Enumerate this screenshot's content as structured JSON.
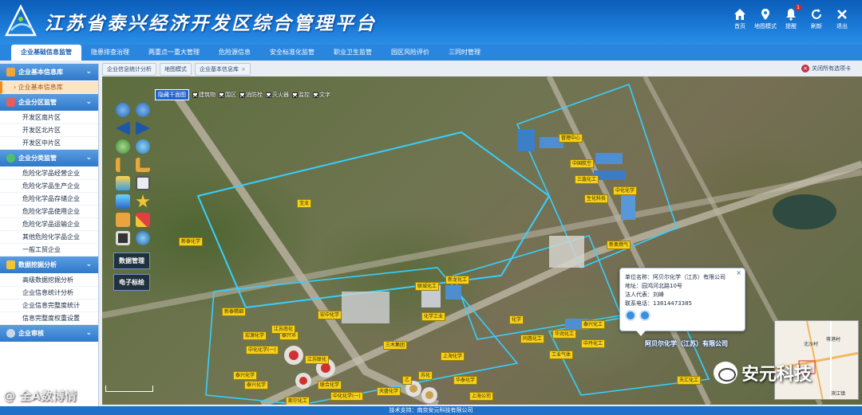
{
  "app": {
    "title": "江苏省泰兴经济开发区综合管理平台",
    "footer": "技术支持：南京安元科技有限公司"
  },
  "top_actions": [
    {
      "label": "首页",
      "icon": "home-icon"
    },
    {
      "label": "地图模式",
      "icon": "map-pin-icon"
    },
    {
      "label": "提醒",
      "icon": "bell-icon",
      "badge": "1"
    },
    {
      "label": "刷新",
      "icon": "refresh-icon"
    },
    {
      "label": "退出",
      "icon": "close-icon"
    }
  ],
  "main_nav": [
    "企业基础信息监管",
    "隐患排查治理",
    "两重点一重大管理",
    "危险源信息",
    "安全标准化监管",
    "职业卫生监管",
    "园区风险评价",
    "三同时管理"
  ],
  "sidebar": {
    "sections": [
      {
        "title": "企业基本信息库",
        "items": [
          "企业基本信息库"
        ]
      },
      {
        "title": "企业分区监管",
        "items": [
          "开发区南片区",
          "开发区北片区",
          "开发区中片区"
        ]
      },
      {
        "title": "企业分类监管",
        "items": [
          "危险化学品经营企业",
          "危险化学品生产企业",
          "危险化学品存储企业",
          "危险化学品使用企业",
          "危险化学品运输企业",
          "其他危险化学品企业",
          "一般工贸企业"
        ]
      },
      {
        "title": "数据挖掘分析",
        "items": [
          "高级数据挖掘分析",
          "企业信息统计分析",
          "企业信息完整度统计",
          "信息完整度权重设置"
        ]
      },
      {
        "title": "企业审核",
        "items": []
      }
    ],
    "active_item": "企业基本信息库"
  },
  "sub_tabs": [
    "企业信息统计分析",
    "地图模式",
    "企业基本信息库"
  ],
  "close_all_label": "关闭所有选项卡",
  "map": {
    "layer_main": "隐藏干面图",
    "layers": [
      "建筑物",
      "围区",
      "消防栓",
      "灭火器",
      "监控",
      "文字"
    ],
    "tool_buttons": [
      "数据管理",
      "电子标绘"
    ],
    "labels": [
      "管理中心",
      "中国航空",
      "三鑫化工",
      "生化科技",
      "中化化学",
      "宝龙",
      "新泰化学",
      "新龙化工",
      "联城化工",
      "新奥燃气",
      "新泰精细",
      "宏中化学",
      "化学工业",
      "泰兴化工",
      "华润化工",
      "同惠化工",
      "中丹化工",
      "宏源化学",
      "泰兴市",
      "三木集团",
      "上海化学",
      "江苏联化",
      "中化化学(一)",
      "泰兴化学",
      "泰兴化学",
      "天盛化学",
      "斯尔化工",
      "天汇化工",
      "联合化学",
      "苏化",
      "华泰化学",
      "中化化学(一)",
      "工业气体",
      "江苏南化",
      "上海公司",
      "化学",
      "乙"
    ],
    "road_label": "阿贝尔化学（江苏）有限公司",
    "popup": {
      "rows": [
        "单位名称：阿贝尔化学（江苏）有限公司",
        "地址：园鸿河北路10号",
        "法人代表：刘峰",
        "联系电话：13814473385"
      ]
    },
    "minimap": {
      "labels": [
        "北沙村",
        "蒋港村",
        "滨江镇"
      ]
    },
    "scale_text": "",
    "watermark": "安元科技",
    "corner_watermark": "@ 全A数博情"
  }
}
